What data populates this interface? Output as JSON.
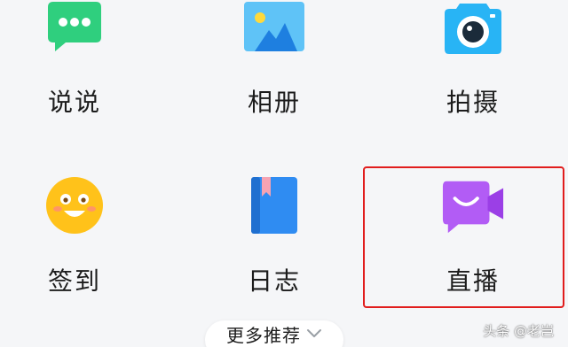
{
  "apps": [
    {
      "label": "说说",
      "icon": "chat-bubble-icon"
    },
    {
      "label": "相册",
      "icon": "photo-album-icon"
    },
    {
      "label": "拍摄",
      "icon": "camera-icon"
    },
    {
      "label": "签到",
      "icon": "smiley-face-icon"
    },
    {
      "label": "日志",
      "icon": "journal-book-icon"
    },
    {
      "label": "直播",
      "icon": "video-camera-icon"
    }
  ],
  "more": {
    "label": "更多推荐",
    "icon": "chevron-down-icon"
  },
  "watermark": {
    "text": "头条 @老岂"
  },
  "colors": {
    "chat": "#2fcf7e",
    "album": "#3aa8f0",
    "camera": "#28b4f5",
    "smiley": "#ffc21a",
    "journal": "#2f8cf2",
    "live": "#b25cf5",
    "highlight_border": "#e11d1d"
  }
}
